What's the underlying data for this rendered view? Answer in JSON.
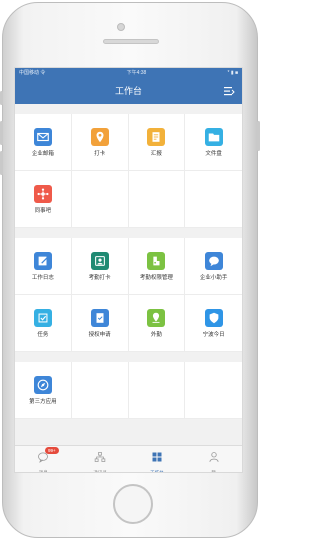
{
  "status_bar": {
    "carrier": "中国移动 令",
    "time": "下午4:38",
    "battery": "* ▮ ■"
  },
  "nav": {
    "title": "工作台",
    "menu_icon": "list-icon"
  },
  "sections": [
    {
      "items": [
        {
          "label": "企业邮箱",
          "icon": "mail-icon",
          "color": "#3e86d8"
        },
        {
          "label": "打卡",
          "icon": "location-pin-icon",
          "color": "#f2a13a"
        },
        {
          "label": "汇报",
          "icon": "report-icon",
          "color": "#f2b13a"
        },
        {
          "label": "文件盘",
          "icon": "folder-icon",
          "color": "#35b0e3"
        },
        {
          "label": "同事吧",
          "icon": "network-icon",
          "color": "#ef5a4a"
        }
      ]
    },
    {
      "items": [
        {
          "label": "工作日志",
          "icon": "edit-log-icon",
          "color": "#3e86d8"
        },
        {
          "label": "考勤打卡",
          "icon": "attendance-icon",
          "color": "#1f8a73"
        },
        {
          "label": "考勤权限管理",
          "icon": "permission-icon",
          "color": "#7cc242"
        },
        {
          "label": "企业小助手",
          "icon": "assistant-chat-icon",
          "color": "#3e86d8"
        },
        {
          "label": "任务",
          "icon": "task-icon",
          "color": "#35b0e3"
        },
        {
          "label": "授权申请",
          "icon": "authorization-icon",
          "color": "#3e86d8"
        },
        {
          "label": "外勤",
          "icon": "field-location-icon",
          "color": "#7cc242"
        },
        {
          "label": "宁波今日",
          "icon": "news-shield-icon",
          "color": "#2f95e6"
        }
      ]
    },
    {
      "items": [
        {
          "label": "第三方应用",
          "icon": "compass-icon",
          "color": "#3e86d8"
        }
      ]
    }
  ],
  "tabbar": [
    {
      "label": "消息",
      "icon": "chat-bubble-icon",
      "badge": "99+",
      "active": false
    },
    {
      "label": "通讯录",
      "icon": "contacts-tree-icon",
      "active": false
    },
    {
      "label": "工作台",
      "icon": "grid-icon",
      "active": true
    },
    {
      "label": "我",
      "icon": "person-icon",
      "active": false
    }
  ]
}
